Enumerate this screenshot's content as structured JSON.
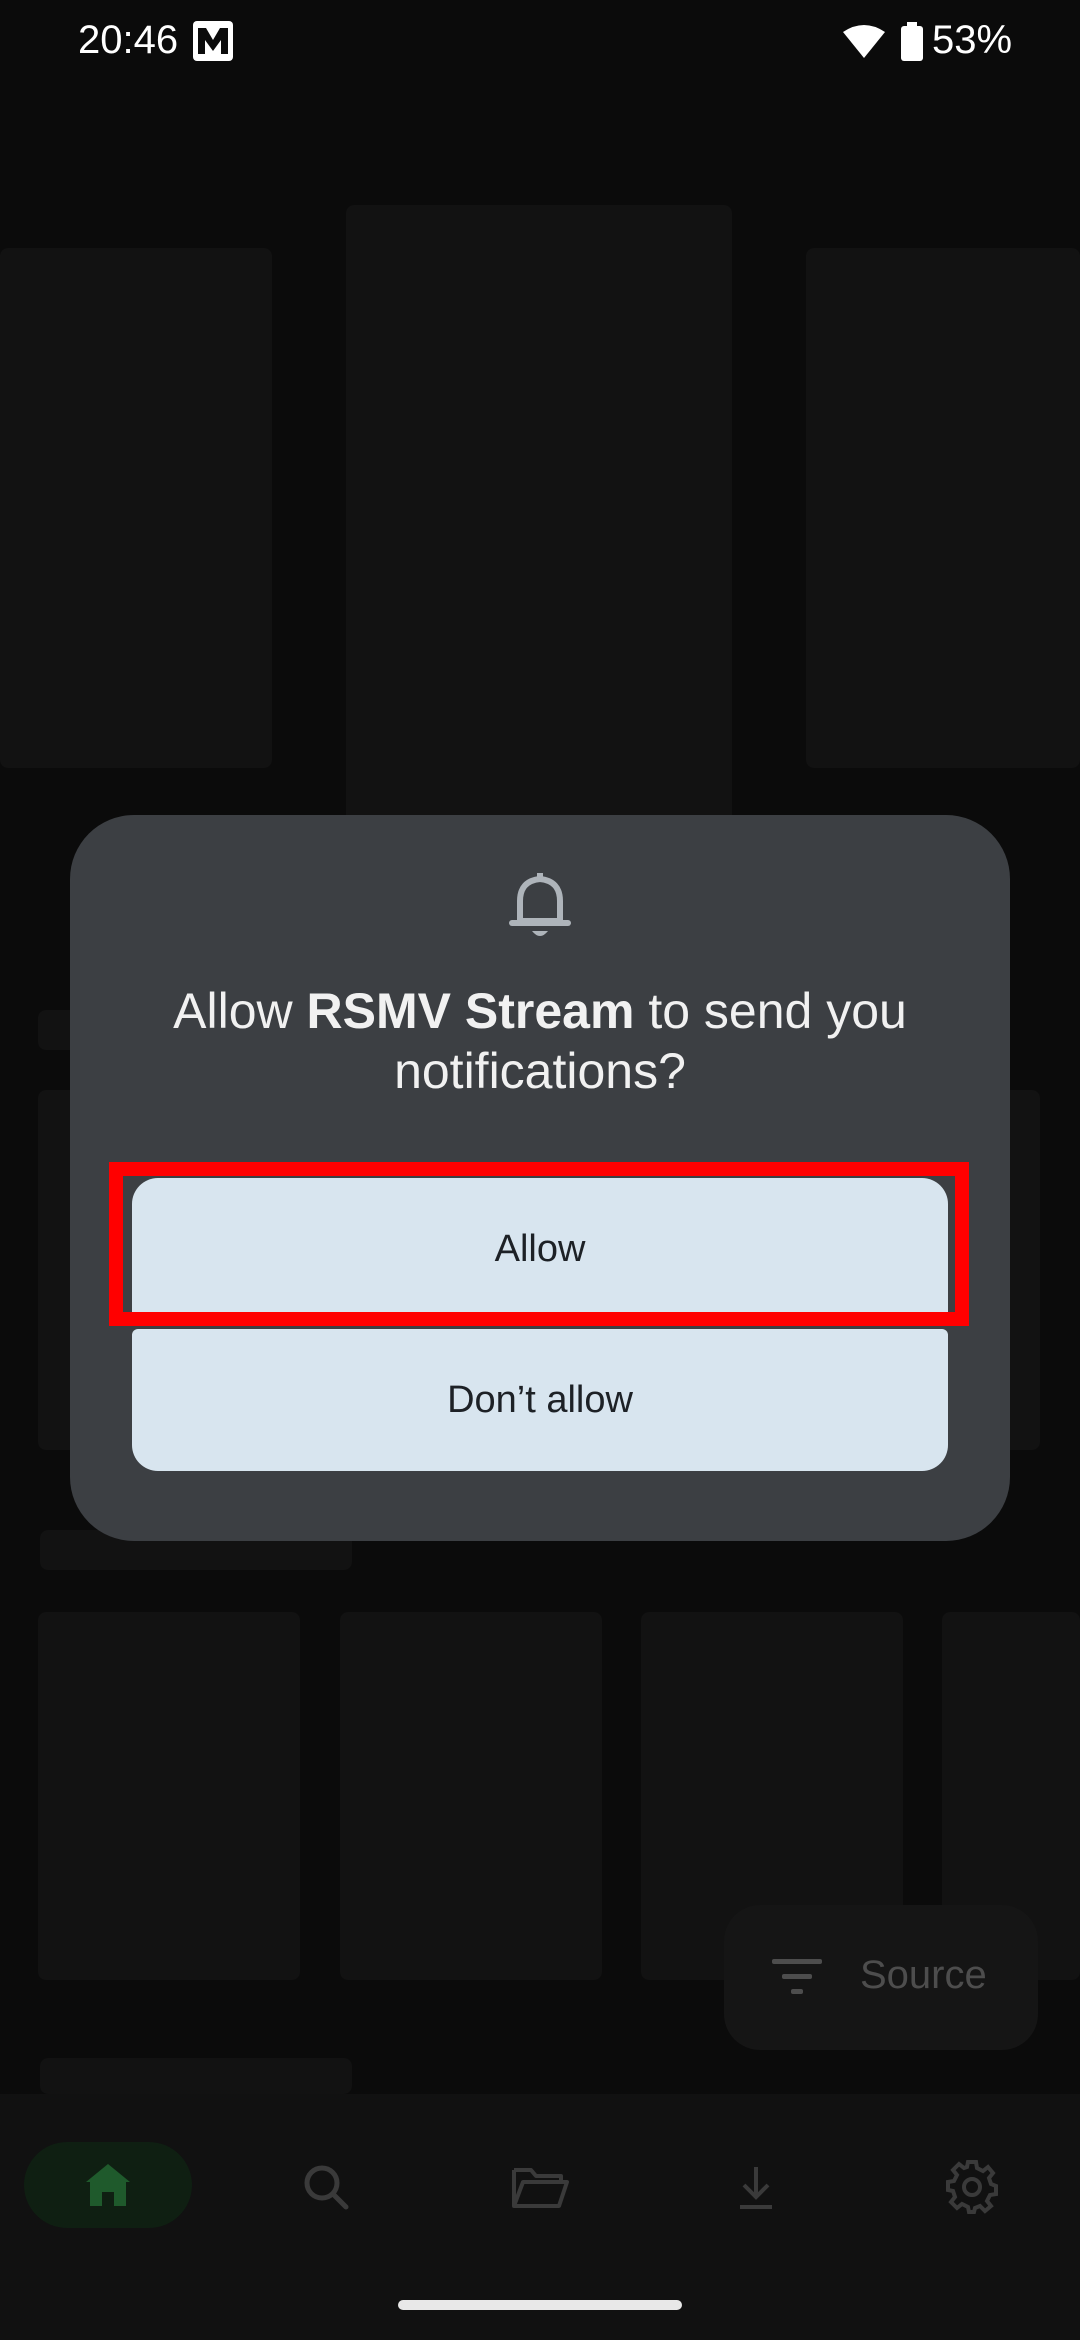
{
  "status_bar": {
    "time": "20:46",
    "battery_percent": "53%",
    "icons": [
      "app-logo-icon",
      "wifi-icon",
      "battery-icon"
    ]
  },
  "dialog": {
    "icon": "bell-icon",
    "title_prefix": "Allow ",
    "app_name": "RSMV Stream",
    "title_suffix": " to send you notifications?",
    "allow_label": "Allow",
    "deny_label": "Don’t allow"
  },
  "fab": {
    "label": "Source",
    "icon": "filter-icon"
  },
  "bottom_nav": {
    "items": [
      "home-icon",
      "search-icon",
      "folder-icon",
      "download-icon",
      "settings-icon"
    ],
    "active": "home-icon"
  },
  "colors": {
    "dialog_bg": "#3c3f43",
    "button_bg": "#d8e5ef",
    "highlight": "#ff0000",
    "home_active": "#1f5a2c"
  }
}
